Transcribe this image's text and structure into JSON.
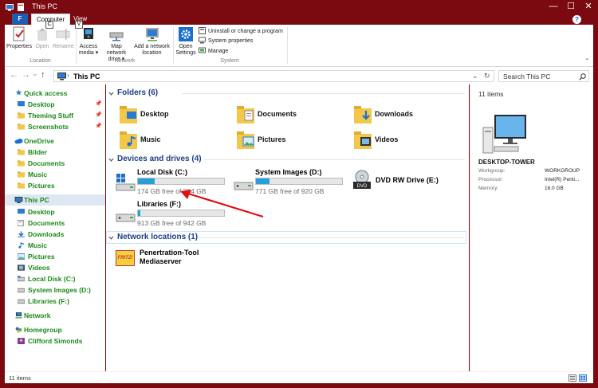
{
  "window": {
    "title": "This PC",
    "minimize": "—",
    "maximize": "☐",
    "close": "✕"
  },
  "tabs": {
    "file": "F",
    "computer": "Computer",
    "view": "View",
    "key_c": "C",
    "key_v": "V",
    "help": "?"
  },
  "ribbon": {
    "properties": "Properties",
    "open": "Open",
    "rename": "Rename",
    "access_media_1": "Access",
    "access_media_2": "media ▾",
    "map_drive_1": "Map network",
    "map_drive_2": "drive ▾",
    "add_location_1": "Add a network",
    "add_location_2": "location",
    "open_settings_1": "Open",
    "open_settings_2": "Settings",
    "uninstall": "Uninstall or change a program",
    "system_properties": "System properties",
    "manage": "Manage",
    "group_location": "Location",
    "group_network": "Network",
    "group_system": "System"
  },
  "navbar": {
    "back": "←",
    "forward": "→",
    "recent": "⌄",
    "up": "↑",
    "path": "This PC",
    "dropdown": "⌄",
    "refresh": "↻",
    "search_placeholder": "Search This PC"
  },
  "sidebar": {
    "items": [
      {
        "label": "Quick access"
      },
      {
        "label": "Desktop"
      },
      {
        "label": "Theming Stuff"
      },
      {
        "label": "Screenshots"
      },
      {
        "label": "OneDrive"
      },
      {
        "label": "Bilder"
      },
      {
        "label": "Documents"
      },
      {
        "label": "Music"
      },
      {
        "label": "Pictures"
      },
      {
        "label": "This PC"
      },
      {
        "label": "Desktop"
      },
      {
        "label": "Documents"
      },
      {
        "label": "Downloads"
      },
      {
        "label": "Music"
      },
      {
        "label": "Pictures"
      },
      {
        "label": "Videos"
      },
      {
        "label": "Local Disk (C:)"
      },
      {
        "label": "System Images (D:)"
      },
      {
        "label": "Libraries (F:)"
      },
      {
        "label": "Network"
      },
      {
        "label": "Homegroup"
      },
      {
        "label": "Clifford Simonds"
      }
    ]
  },
  "main": {
    "folders_header": "Folders (6)",
    "folders": [
      {
        "label": "Desktop"
      },
      {
        "label": "Documents"
      },
      {
        "label": "Downloads"
      },
      {
        "label": "Music"
      },
      {
        "label": "Pictures"
      },
      {
        "label": "Videos"
      }
    ],
    "drives_header": "Devices and drives (4)",
    "drives": [
      {
        "name": "Local Disk (C:)",
        "free": "174 GB free of 214 GB",
        "used_fraction": 0.19
      },
      {
        "name": "System Images (D:)",
        "free": "771 GB free of 920 GB",
        "used_fraction": 0.16
      },
      {
        "name": "DVD RW Drive (E:)"
      },
      {
        "name": "Libraries (F:)",
        "free": "913 GB free of 942 GB",
        "used_fraction": 0.03
      }
    ],
    "network_header": "Network locations (1)",
    "network_item_line1": "Penertration-Tool",
    "network_item_line2": "Mediaserver",
    "fritz_logo": "FRITZ!"
  },
  "details": {
    "count": "11 items",
    "computer_name": "DESKTOP-TOWER",
    "workgroup_label": "Workgroup:",
    "workgroup_value": "WORKGROUP",
    "processor_label": "Processor:",
    "processor_value": "Intel(R) Penti...",
    "memory_label": "Memory:",
    "memory_value": "16.0 GB"
  },
  "status": {
    "items": "11 items"
  },
  "colors": {
    "frame": "#7a0a10",
    "nav_green": "#1a8a1a",
    "section_blue": "#1e3c8c",
    "drive_fill": "#26a0da",
    "annotation_arrow": "#e01010"
  }
}
